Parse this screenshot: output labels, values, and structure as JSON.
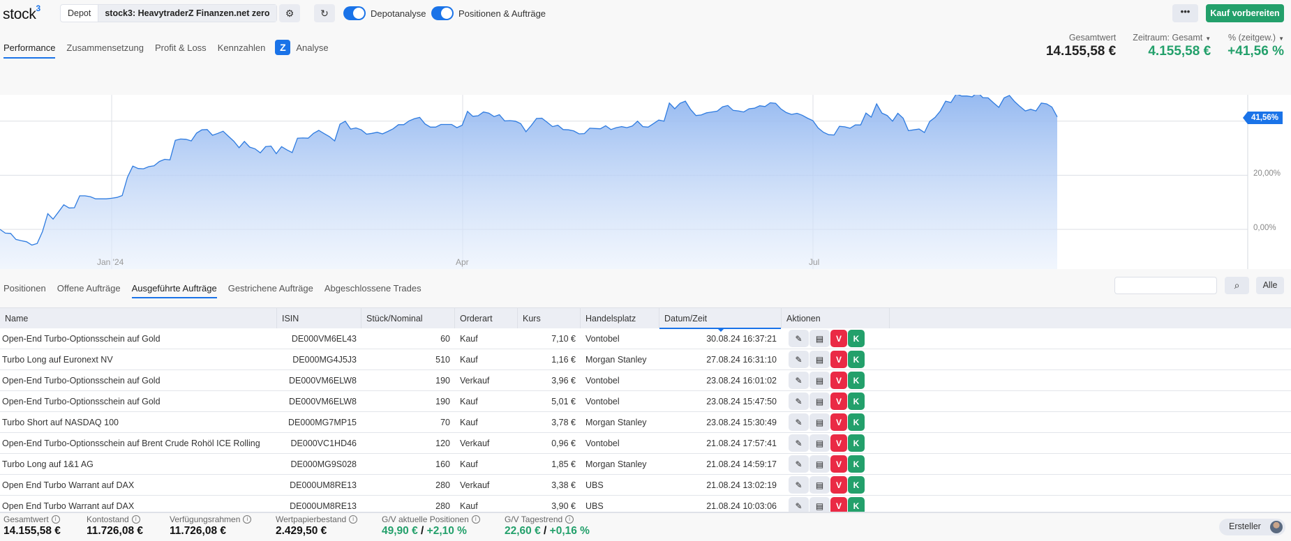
{
  "app": {
    "logo": "stock",
    "logo_sup": "3"
  },
  "toolbar": {
    "depot_label": "Depot",
    "depot_value": "stock3: HeavytraderZ Finanzen.net zero",
    "toggles": [
      {
        "label": "Depotanalyse",
        "on": true
      },
      {
        "label": "Positionen & Aufträge",
        "on": true
      }
    ],
    "more_label": "•••",
    "buy_label": "Kauf vorbereiten"
  },
  "top_tabs": [
    {
      "label": "Performance",
      "active": true
    },
    {
      "label": "Zusammensetzung",
      "active": false
    },
    {
      "label": "Profit & Loss",
      "active": false
    },
    {
      "label": "Kennzahlen",
      "active": false
    },
    {
      "label": "Analyse",
      "active": false,
      "icon": "Z"
    }
  ],
  "summary": {
    "gesamtwert_label": "Gesamtwert",
    "gesamtwert_value": "14.155,58 €",
    "zeitraum_label": "Zeitraum: Gesamt",
    "zeitraum_value": "4.155,58 €",
    "pct_label": "% (zeitgew.)",
    "pct_value": "+41,56 %"
  },
  "chart_data": {
    "type": "area",
    "title": "",
    "xlabel": "",
    "ylabel": "",
    "x_ticks": [
      "Jan '24",
      "Apr",
      "Jul"
    ],
    "y_ticks": [
      "0,00%",
      "20,00%"
    ],
    "ylim": [
      -15,
      55
    ],
    "last_value_label": "41,56%",
    "color": "#1a73e8",
    "grid": true,
    "series": [
      {
        "name": "Performance (%)",
        "values": [
          0.0,
          -1.4,
          -1.5,
          -3.7,
          -4.2,
          -4.6,
          -5.8,
          -5.2,
          -0.8,
          5.8,
          3.8,
          6.4,
          9.1,
          7.9,
          8.0,
          12.4,
          12.4,
          12.1,
          11.3,
          11.3,
          11.3,
          11.5,
          11.8,
          12.5,
          19.3,
          23.4,
          22.5,
          22.4,
          23.2,
          23.5,
          25.1,
          25.9,
          25.7,
          32.9,
          33.4,
          33.3,
          32.7,
          35.6,
          36.8,
          36.9,
          34.8,
          35.5,
          36.3,
          34.4,
          32.6,
          30.2,
          32.5,
          30.4,
          29.8,
          28.3,
          30.6,
          30.8,
          28.0,
          30.6,
          29.4,
          28.4,
          33.7,
          33.8,
          33.7,
          35.5,
          36.6,
          35.4,
          34.3,
          32.7,
          38.9,
          40.0,
          37.1,
          37.5,
          36.8,
          35.2,
          35.5,
          35.9,
          35.3,
          36.2,
          37.2,
          38.7,
          38.7,
          40.1,
          40.9,
          41.4,
          39.0,
          37.8,
          37.8,
          38.8,
          38.8,
          38.8,
          37.6,
          38.5,
          43.6,
          41.8,
          42.0,
          43.4,
          43.0,
          41.7,
          42.4,
          40.1,
          40.2,
          40.0,
          39.1,
          36.1,
          38.4,
          41.0,
          41.1,
          39.6,
          38.0,
          38.5,
          36.9,
          36.8,
          36.4,
          35.3,
          35.4,
          37.4,
          37.3,
          37.2,
          38.3,
          36.9,
          37.6,
          38.0,
          37.6,
          38.2,
          40.0,
          38.0,
          37.8,
          39.1,
          40.4,
          40.0,
          46.7,
          44.6,
          46.6,
          47.4,
          44.3,
          42.1,
          42.3,
          43.1,
          43.4,
          43.7,
          45.3,
          45.8,
          44.0,
          43.8,
          43.4,
          44.6,
          44.8,
          45.7,
          45.4,
          46.8,
          46.6,
          44.5,
          43.2,
          42.5,
          42.9,
          42.2,
          41.1,
          40.2,
          37.5,
          35.9,
          35.0,
          34.9,
          38.1,
          37.9,
          37.4,
          38.6,
          38.6,
          43.0,
          41.5,
          46.4,
          43.0,
          42.1,
          40.0,
          42.9,
          41.1,
          36.5,
          36.8,
          37.1,
          35.8,
          39.9,
          41.4,
          43.8,
          47.4,
          46.9,
          50.1,
          49.3,
          49.3,
          49.0,
          50.7,
          48.7,
          48.6,
          46.8,
          45.1,
          48.6,
          49.5,
          47.2,
          45.4,
          43.8,
          44.4,
          43.8,
          46.7,
          46.4,
          45.2,
          41.56
        ]
      }
    ]
  },
  "bottom_tabs": [
    {
      "label": "Positionen",
      "active": false
    },
    {
      "label": "Offene Aufträge",
      "active": false
    },
    {
      "label": "Ausgeführte Aufträge",
      "active": true
    },
    {
      "label": "Gestrichene Aufträge",
      "active": false
    },
    {
      "label": "Abgeschlossene Trades",
      "active": false
    }
  ],
  "search": {
    "placeholder": "",
    "value": "",
    "button_icon": "search-icon",
    "filter_label": "Alle"
  },
  "table": {
    "columns": [
      "Name",
      "ISIN",
      "Stück/Nominal",
      "Orderart",
      "Kurs",
      "Handelsplatz",
      "Datum/Zeit",
      "Aktionen"
    ],
    "sorted_column": "Datum/Zeit",
    "rows": [
      {
        "name": "Open-End Turbo-Optionsschein auf Gold",
        "isin": "DE000VM6EL43",
        "qty": "60",
        "type": "Kauf",
        "kurs": "7,10 €",
        "place": "Vontobel",
        "date": "30.08.24 16:37:21"
      },
      {
        "name": "Turbo Long auf Euronext NV",
        "isin": "DE000MG4J5J3",
        "qty": "510",
        "type": "Kauf",
        "kurs": "1,16 €",
        "place": "Morgan Stanley",
        "date": "27.08.24 16:31:10"
      },
      {
        "name": "Open-End Turbo-Optionsschein auf Gold",
        "isin": "DE000VM6ELW8",
        "qty": "190",
        "type": "Verkauf",
        "kurs": "3,96 €",
        "place": "Vontobel",
        "date": "23.08.24 16:01:02"
      },
      {
        "name": "Open-End Turbo-Optionsschein auf Gold",
        "isin": "DE000VM6ELW8",
        "qty": "190",
        "type": "Kauf",
        "kurs": "5,01 €",
        "place": "Vontobel",
        "date": "23.08.24 15:47:50"
      },
      {
        "name": "Turbo Short auf NASDAQ 100",
        "isin": "DE000MG7MP15",
        "qty": "70",
        "type": "Kauf",
        "kurs": "3,78 €",
        "place": "Morgan Stanley",
        "date": "23.08.24 15:30:49"
      },
      {
        "name": "Open-End Turbo-Optionsschein auf Brent Crude Rohöl ICE Rolling",
        "isin": "DE000VC1HD46",
        "qty": "120",
        "type": "Verkauf",
        "kurs": "0,96 €",
        "place": "Vontobel",
        "date": "21.08.24 17:57:41"
      },
      {
        "name": "Turbo Long auf 1&1 AG",
        "isin": "DE000MG9S028",
        "qty": "160",
        "type": "Kauf",
        "kurs": "1,85 €",
        "place": "Morgan Stanley",
        "date": "21.08.24 14:59:17"
      },
      {
        "name": "Open End Turbo Warrant auf DAX",
        "isin": "DE000UM8RE13",
        "qty": "280",
        "type": "Verkauf",
        "kurs": "3,38 €",
        "place": "UBS",
        "date": "21.08.24 13:02:19"
      },
      {
        "name": "Open End Turbo Warrant auf DAX",
        "isin": "DE000UM8RE13",
        "qty": "280",
        "type": "Kauf",
        "kurs": "3,90 €",
        "place": "UBS",
        "date": "21.08.24 10:03:06"
      }
    ],
    "actions": {
      "edit_icon": "✎",
      "receipt_icon": "▤",
      "sell_label": "V",
      "buy_label": "K"
    }
  },
  "footer": {
    "stats": [
      {
        "label": "Gesamtwert",
        "value": "14.155,58 €"
      },
      {
        "label": "Kontostand",
        "value": "11.726,08 €"
      },
      {
        "label": "Verfügungsrahmen",
        "value": "11.726,08 €"
      },
      {
        "label": "Wertpapierbestand",
        "value": "2.429,50 €"
      },
      {
        "label": "G/V aktuelle Positionen",
        "value_abs": "49,90 €",
        "sep": " / ",
        "value_pct": "+2,10 %"
      },
      {
        "label": "G/V Tagestrend",
        "value_abs": "22,60 €",
        "sep": " / ",
        "value_pct": "+0,16 %"
      }
    ],
    "ersteller_label": "Ersteller"
  }
}
